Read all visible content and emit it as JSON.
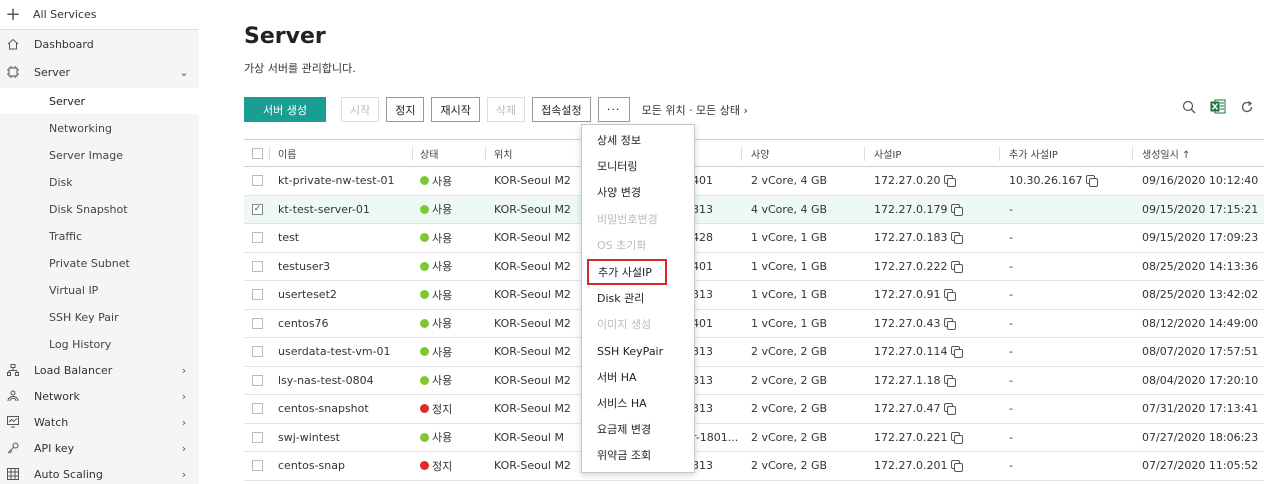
{
  "sidebar": {
    "all_services": "All Services",
    "dashboard": "Dashboard",
    "server": "Server",
    "server_subitems": [
      "Server",
      "Networking",
      "Server Image",
      "Disk",
      "Disk Snapshot",
      "Traffic",
      "Private Subnet",
      "Virtual IP",
      "SSH Key Pair",
      "Log History"
    ],
    "groups": [
      "Load Balancer",
      "Network",
      "Watch",
      "API key",
      "Auto Scaling"
    ]
  },
  "page": {
    "title": "Server",
    "subtitle": "가상 서버를 관리합니다."
  },
  "toolbar": {
    "create": "서버 생성",
    "start": "시작",
    "stop": "정지",
    "restart": "재시작",
    "delete": "삭제",
    "connect_settings": "접속설정",
    "more": "···",
    "filter": "모든 위치 · 모든 상태 ›"
  },
  "table": {
    "headers": {
      "name": "이름",
      "status": "상태",
      "location": "위치",
      "spec": "사양",
      "private_ip": "사설IP",
      "extra_ip": "추가 사설IP",
      "created": "생성일시 ↑"
    },
    "rows": [
      {
        "name": "kt-private-nw-test-01",
        "status": "사용",
        "status_color": "#7dc832",
        "location": "KOR-Seoul M2",
        "id": "401",
        "spec": "2 vCore, 4 GB",
        "private_ip": "172.27.0.20",
        "extra_ip": "10.30.26.167",
        "created": "09/16/2020 10:12:40"
      },
      {
        "name": "kt-test-server-01",
        "status": "사용",
        "status_color": "#7dc832",
        "location": "KOR-Seoul M2",
        "id": "313",
        "spec": "4 vCore, 4 GB",
        "private_ip": "172.27.0.179",
        "extra_ip": "-",
        "created": "09/15/2020 17:15:21"
      },
      {
        "name": "test",
        "status": "사용",
        "status_color": "#7dc832",
        "location": "KOR-Seoul M2",
        "id": "428",
        "spec": "1 vCore, 1 GB",
        "private_ip": "172.27.0.183",
        "extra_ip": "-",
        "created": "09/15/2020 17:09:23"
      },
      {
        "name": "testuser3",
        "status": "사용",
        "status_color": "#7dc832",
        "location": "KOR-Seoul M2",
        "id": "401",
        "spec": "1 vCore, 1 GB",
        "private_ip": "172.27.0.222",
        "extra_ip": "-",
        "created": "08/25/2020 14:13:36"
      },
      {
        "name": "userteset2",
        "status": "사용",
        "status_color": "#7dc832",
        "location": "KOR-Seoul M2",
        "id": "313",
        "spec": "1 vCore, 1 GB",
        "private_ip": "172.27.0.91",
        "extra_ip": "-",
        "created": "08/25/2020 13:42:02"
      },
      {
        "name": "centos76",
        "status": "사용",
        "status_color": "#7dc832",
        "location": "KOR-Seoul M2",
        "id": "401",
        "spec": "1 vCore, 1 GB",
        "private_ip": "172.27.0.43",
        "extra_ip": "-",
        "created": "08/12/2020 14:49:00"
      },
      {
        "name": "userdata-test-vm-01",
        "status": "사용",
        "status_color": "#7dc832",
        "location": "KOR-Seoul M2",
        "id": "313",
        "spec": "2 vCore, 2 GB",
        "private_ip": "172.27.0.114",
        "extra_ip": "-",
        "created": "08/07/2020 17:57:51"
      },
      {
        "name": "lsy-nas-test-0804",
        "status": "사용",
        "status_color": "#7dc832",
        "location": "KOR-Seoul M2",
        "id": "313",
        "spec": "2 vCore, 2 GB",
        "private_ip": "172.27.1.18",
        "extra_ip": "-",
        "created": "08/04/2020 17:20:10"
      },
      {
        "name": "centos-snapshot",
        "status": "정지",
        "status_color": "#e02a2a",
        "location": "KOR-Seoul M2",
        "id": "313",
        "spec": "2 vCore, 2 GB",
        "private_ip": "172.27.0.47",
        "extra_ip": "-",
        "created": "07/31/2020 17:13:41"
      },
      {
        "name": "swj-wintest",
        "status": "사용",
        "status_color": "#7dc832",
        "location": "KOR-Seoul M",
        "id": "r-1801...",
        "spec": "2 vCore, 2 GB",
        "private_ip": "172.27.0.221",
        "extra_ip": "-",
        "created": "07/27/2020 18:06:23"
      },
      {
        "name": "centos-snap",
        "status": "정지",
        "status_color": "#e02a2a",
        "location": "KOR-Seoul M2",
        "id": "313",
        "spec": "2 vCore, 2 GB",
        "private_ip": "172.27.0.201",
        "extra_ip": "-",
        "created": "07/27/2020 11:05:52"
      }
    ]
  },
  "dropdown": {
    "items": [
      "상세 정보",
      "모니터링",
      "사양 변경",
      "비밀번호변경",
      "OS 초기화",
      "추가 사설IP",
      "Disk 관리",
      "이미지 생성",
      "SSH KeyPair",
      "서버 HA",
      "서비스 HA",
      "요금제 변경",
      "위약금 조회"
    ]
  },
  "colors": {
    "primary": "#1a9e94",
    "status_active": "#7dc832",
    "status_stopped": "#e02a2a",
    "highlight_box": "#d9272e",
    "excel": "#1e7145"
  }
}
